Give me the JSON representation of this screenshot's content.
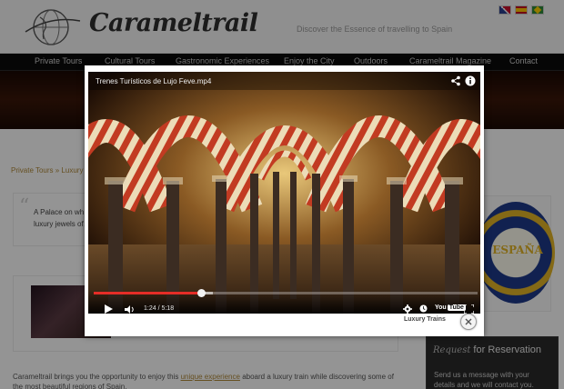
{
  "site": {
    "logo": "Carameltrail",
    "tagline": "Discover the Essence of travelling to Spain",
    "languages": [
      "English",
      "Español",
      "Português"
    ]
  },
  "nav": {
    "items": [
      "Private Tours",
      "Cultural Tours",
      "Gastronomic Experiences",
      "Enjoy the City",
      "Outdoors",
      "Carameltrail Magazine",
      "Contact"
    ]
  },
  "breadcrumb": "Private Tours » Luxury",
  "quote": "A Palace on wh… luxury jewels of…",
  "body": {
    "text_before": "Carameltrail brings you the opportunity to enjoy this",
    "link": "unique experience",
    "text_after": "aboard a luxury train while discovering some of the most beautiful regions of Spain."
  },
  "badge": {
    "text": "ESPAÑA"
  },
  "reservation": {
    "title_italic": "Request",
    "title_main": "for Reservation",
    "text": "Send us a message with your details and we will contact you."
  },
  "modal": {
    "video_title": "Trenes Turísticos de Lujo Feve.mp4",
    "time_current": "1:24",
    "time_total": "5:18",
    "progress": 0.28,
    "buffered": 0.31,
    "youtube_label": "You",
    "youtube_box": "Tube",
    "caption": "Luxury Trains"
  },
  "colors": {
    "accent": "#b08a3a",
    "nav_bg": "#0c0c0c",
    "progress": "#e52d27"
  }
}
